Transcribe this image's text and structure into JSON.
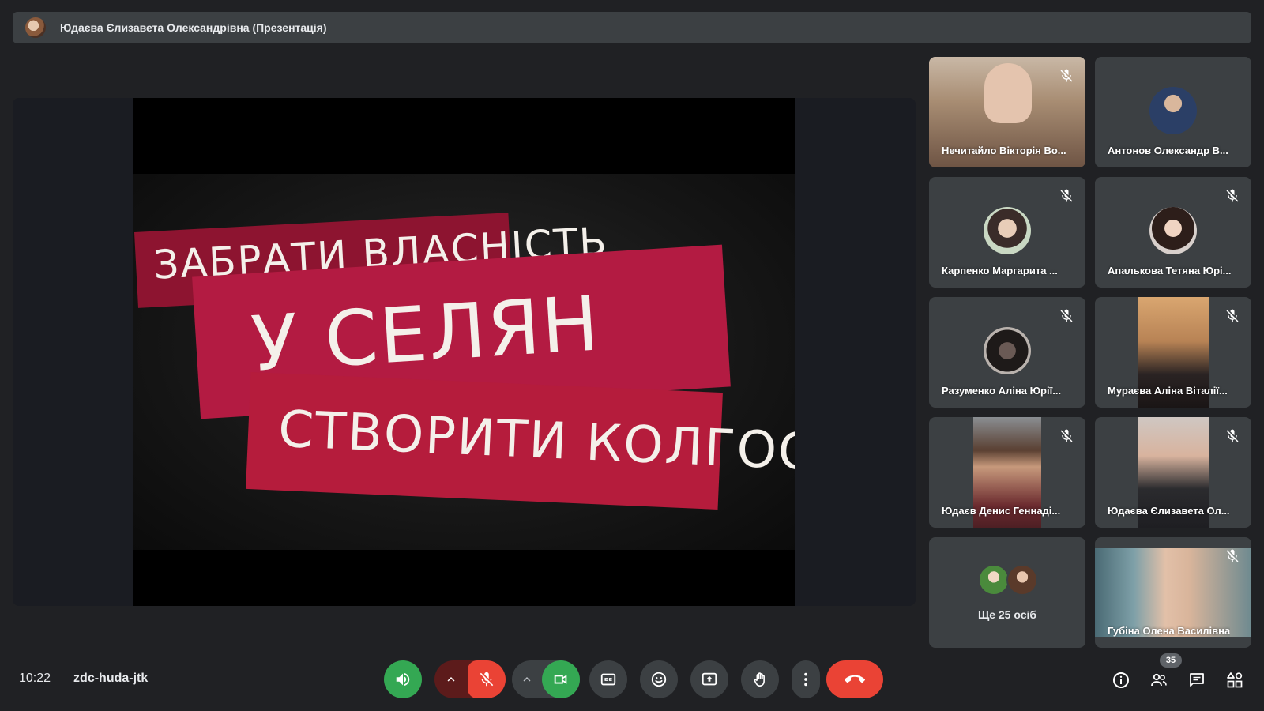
{
  "presenter": {
    "name": "Юдаєва Єлизавета Олександрівна (Презентація)"
  },
  "slide": {
    "line1": "ЗАБРАТИ ВЛАСНІСТЬ",
    "line2": "У СЕЛЯН",
    "line3": "СТВОРИТИ КОЛГОСПИ"
  },
  "participants": [
    {
      "name": "Нечитайло Вікторія Во...",
      "muted": true,
      "kind": "video"
    },
    {
      "name": "Антонов Олександр В...",
      "muted": false,
      "kind": "avatar"
    },
    {
      "name": "Карпенко Маргарита ...",
      "muted": true,
      "kind": "avatar"
    },
    {
      "name": "Апалькова Тетяна Юрі...",
      "muted": true,
      "kind": "avatar"
    },
    {
      "name": "Разуменко Аліна Юрії...",
      "muted": true,
      "kind": "avatar"
    },
    {
      "name": "Мураєва Аліна Віталії...",
      "muted": true,
      "kind": "video"
    },
    {
      "name": "Юдаєв Денис Геннаді...",
      "muted": true,
      "kind": "video"
    },
    {
      "name": "Юдаєва Єлизавета Ол...",
      "muted": true,
      "kind": "video"
    },
    {
      "name": "Губіна Олена Василівна",
      "muted": true,
      "kind": "video"
    }
  ],
  "more": {
    "label": "Ще 25 осіб"
  },
  "meeting": {
    "time": "10:22",
    "code": "zdc-huda-jtk"
  },
  "people_count": "35",
  "colors": {
    "background": "#202124",
    "tile": "#3c4043",
    "green": "#34a853",
    "red": "#ea4335"
  }
}
